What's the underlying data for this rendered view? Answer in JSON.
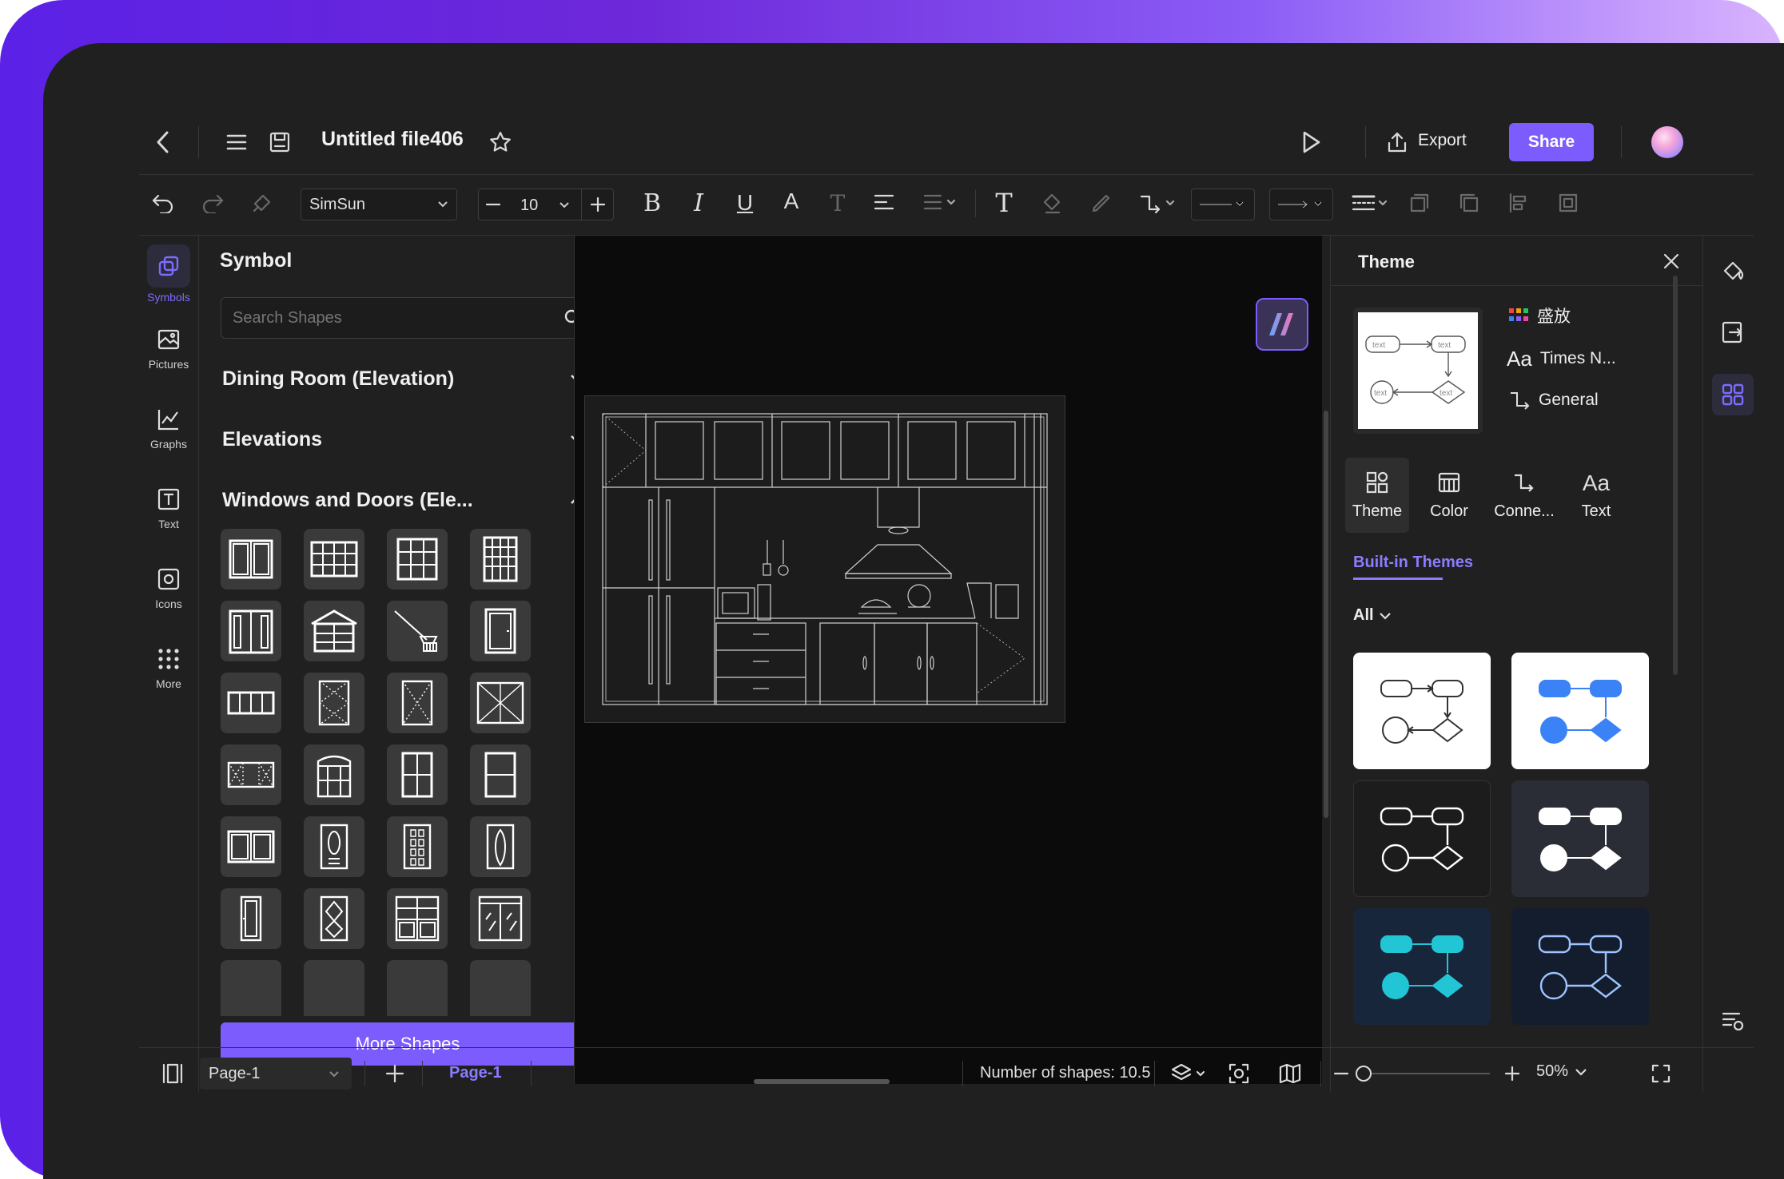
{
  "header": {
    "file_name": "Untitled file406",
    "export_label": "Export",
    "share_label": "Share"
  },
  "toolbar": {
    "font_family": "SimSun",
    "font_size": "10"
  },
  "left_rail": {
    "items": [
      {
        "label": "Symbols",
        "icon": "symbols-icon",
        "active": true
      },
      {
        "label": "Pictures",
        "icon": "picture-icon"
      },
      {
        "label": "Graphs",
        "icon": "graph-icon"
      },
      {
        "label": "Text",
        "icon": "text-icon"
      },
      {
        "label": "Icons",
        "icon": "icons-icon"
      },
      {
        "label": "More",
        "icon": "more-icon"
      }
    ]
  },
  "symbol_panel": {
    "title": "Symbol",
    "search_placeholder": "Search Shapes",
    "sections": [
      {
        "label": "Dining Room (Elevation)",
        "expanded": false
      },
      {
        "label": "Elevations",
        "expanded": false
      },
      {
        "label": "Windows and Doors (Ele...",
        "expanded": true
      }
    ],
    "more_shapes_label": "More Shapes"
  },
  "theme_panel": {
    "title": "Theme",
    "current_theme": {
      "palette_name": "盛放",
      "font_name": "Times N...",
      "connector_name": "General",
      "preview_text": "text"
    },
    "tabs": [
      {
        "label": "Theme",
        "active": true
      },
      {
        "label": "Color"
      },
      {
        "label": "Conne..."
      },
      {
        "label": "Text"
      }
    ],
    "builtin_label": "Built-in Themes",
    "filter_label": "All"
  },
  "status_bar": {
    "page_select": "Page-1",
    "page_tab": "Page-1",
    "shapes_label": "Number of shapes: 10.5",
    "zoom": "50%"
  },
  "colors": {
    "accent": "#7c5cfc",
    "app_bg": "#202020",
    "canvas_bg": "#0b0b0b",
    "builtin_blue": "#3b82f6",
    "builtin_teal": "#22c5d4"
  }
}
